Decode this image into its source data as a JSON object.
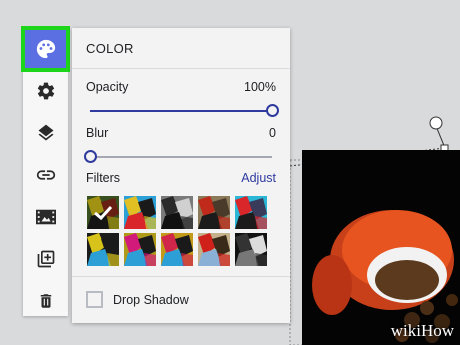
{
  "panel": {
    "title": "COLOR",
    "opacity_label": "Opacity",
    "opacity_value": "100%",
    "opacity_level": 1.0,
    "blur_label": "Blur",
    "blur_value": "0",
    "blur_level": 0.0,
    "filters_label": "Filters",
    "adjust_link": "Adjust",
    "drop_shadow_label": "Drop Shadow"
  },
  "toolbar": {
    "items": [
      {
        "icon": "palette-icon",
        "active": true
      },
      {
        "icon": "gear-icon"
      },
      {
        "icon": "layers-icon"
      },
      {
        "icon": "link-icon"
      },
      {
        "icon": "film-icon"
      },
      {
        "icon": "duplicate-icon"
      },
      {
        "icon": "trash-icon"
      }
    ]
  },
  "filters": {
    "count": 10,
    "selected_index": 0
  },
  "colors": {
    "accent": "#2e3a9e",
    "active_tool": "#5b6fe3",
    "highlight_border": "#1dd51a"
  },
  "watermark": "wikiHow"
}
